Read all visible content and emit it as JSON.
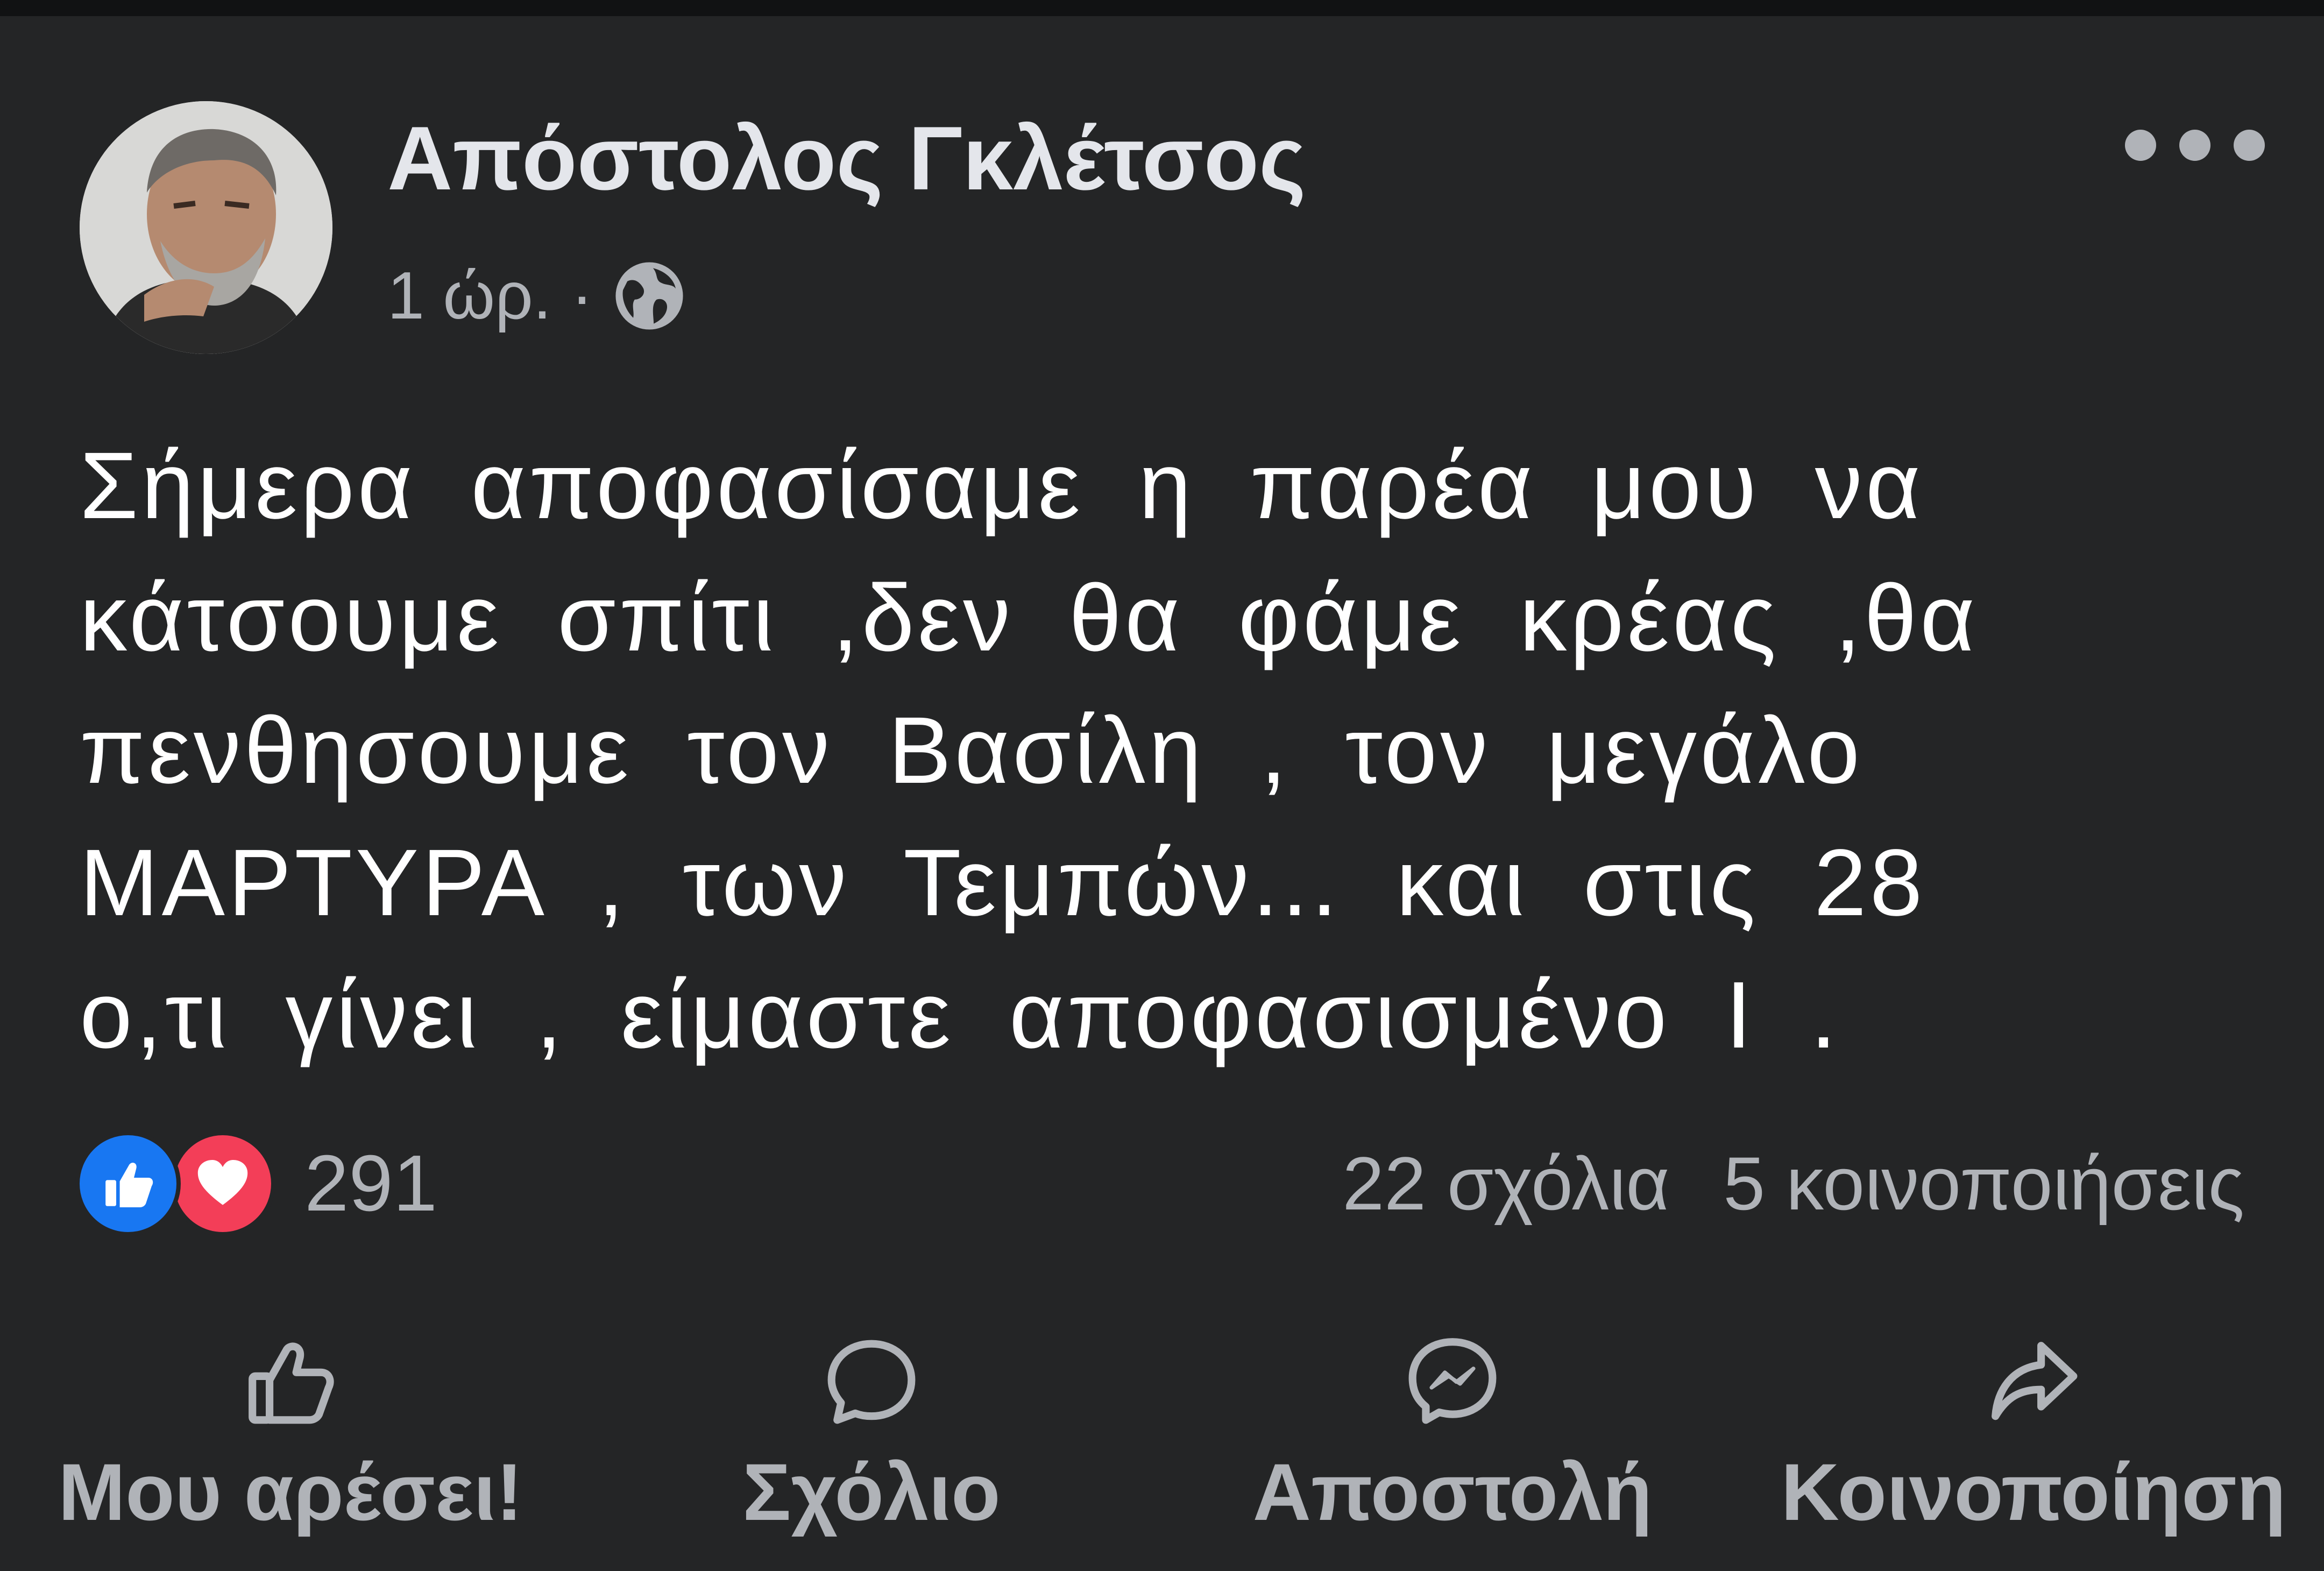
{
  "post": {
    "author": "Απόστολος Γκλέτσος",
    "time": "1 ώρ.",
    "separator": "·",
    "privacy_icon": "globe-icon",
    "text_lines": [
      "Σήμερα  αποφασίσαμε η παρέα  μου να",
      "κάτσουμε σπίτι ,δεν θα φάμε κρέας ,θα",
      "πενθησουμε τον Βασίλη  , τον μεγάλο",
      "ΜΑΡΤΥΡΑ  , των  Τεμπών... και στις 28",
      "ο,τι γίνει  , είμαστε αποφασισμένο Ι    ."
    ]
  },
  "reactions": {
    "icons": [
      "like-reaction-icon",
      "love-reaction-icon"
    ],
    "count": "291",
    "comments": "22 σχόλια",
    "shares": "5 κοινοποιήσεις"
  },
  "actions": {
    "like": "Μου αρέσει!",
    "comment": "Σχόλιο",
    "send": "Αποστολή",
    "share": "Κοινοποίηση"
  },
  "colors": {
    "background": "#242526",
    "text_primary": "#e4e6eb",
    "text_secondary": "#b0b3b8",
    "like_blue": "#1877f2",
    "love_red": "#f33e58"
  }
}
